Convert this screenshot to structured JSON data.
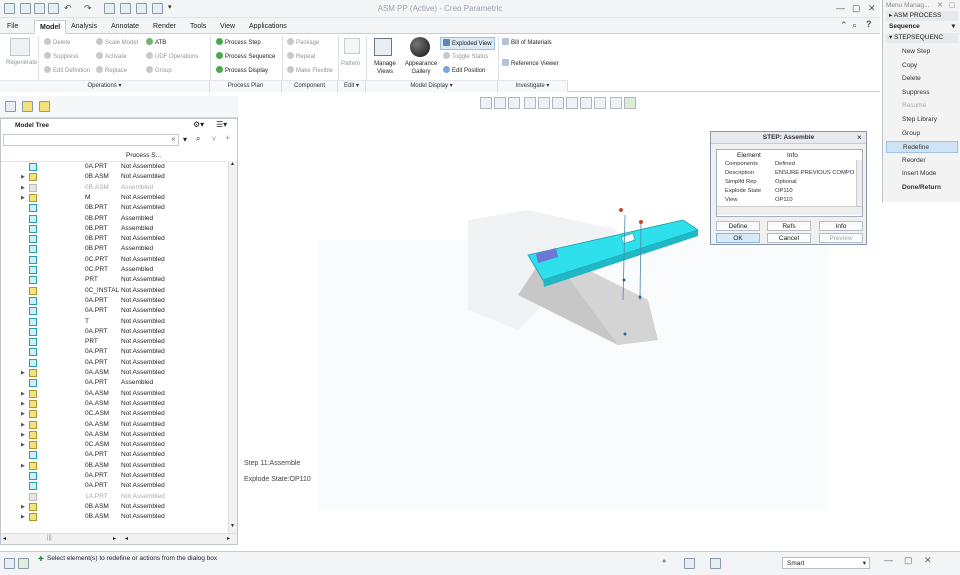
{
  "window": {
    "title": "ASM PP (Active) - Creo Parametric"
  },
  "tabs": [
    "File",
    "Model",
    "Analysis",
    "Annotate",
    "Render",
    "Tools",
    "View",
    "Applications"
  ],
  "ribbon": {
    "regenerate": "Regenerate",
    "operations": {
      "delete": "Delete",
      "suppress": "Suppress",
      "edit_definition": "Edit Definition",
      "scale_model": "Scale Model",
      "activate": "Activate",
      "replace": "Replace",
      "atb": "ATB",
      "udf_operations": "UDF Operations",
      "group": "Group"
    },
    "process": {
      "process_step": "Process Step",
      "process_sequence": "Process Sequence",
      "process_display": "Process Display"
    },
    "component": {
      "package": "Package",
      "repeat": "Repeat",
      "make_flexible": "Make Flexible"
    },
    "pattern": "Pattern",
    "model_display": {
      "manage_views": "Manage Views",
      "appearance_gallery": "Appearance Gallery",
      "exploded_view": "Exploded View",
      "toggle_status": "Toggle Status",
      "edit_position": "Edit Position"
    },
    "investigate": {
      "bom": "Bill of Materials",
      "reference_viewer": "Reference Viewer"
    },
    "groups": [
      "Operations",
      "Process Plan",
      "Component",
      "Edit",
      "Model Display",
      "Investigate"
    ]
  },
  "model_tree": {
    "title": "Model Tree",
    "column_header": "Process S...",
    "rows": [
      {
        "name": "0A.PRT",
        "status": "Not Assembled",
        "type": "prt",
        "tri": false,
        "dim": false
      },
      {
        "name": "0B.ASM",
        "status": "Not Assembled",
        "type": "asm",
        "tri": true,
        "dim": false
      },
      {
        "name": "0B.ASM",
        "status": "Assembled",
        "type": "gray",
        "tri": true,
        "dim": true
      },
      {
        "name": "M",
        "status": "Not Assembled",
        "type": "asm",
        "tri": true,
        "dim": false
      },
      {
        "name": "0B.PRT",
        "status": "Not Assembled",
        "type": "prt",
        "tri": false,
        "dim": false
      },
      {
        "name": "0B.PRT",
        "status": "Assembled",
        "type": "prt",
        "tri": false,
        "dim": false
      },
      {
        "name": "0B.PRT",
        "status": "Assembled",
        "type": "prt",
        "tri": false,
        "dim": false
      },
      {
        "name": "0B.PRT",
        "status": "Not Assembled",
        "type": "prt",
        "tri": false,
        "dim": false
      },
      {
        "name": "0B.PRT",
        "status": "Assembled",
        "type": "prt",
        "tri": false,
        "dim": false
      },
      {
        "name": "0C.PRT",
        "status": "Not Assembled",
        "type": "prt",
        "tri": false,
        "dim": false
      },
      {
        "name": "0C.PRT",
        "status": "Assembled",
        "type": "prt",
        "tri": false,
        "dim": false
      },
      {
        "name": "PRT",
        "status": "Not Assembled",
        "type": "prt",
        "tri": false,
        "dim": false
      },
      {
        "name": "0C_INSTAL",
        "status": "Not Assembled",
        "type": "asm",
        "tri": false,
        "dim": false
      },
      {
        "name": "0A.PRT",
        "status": "Not Assembled",
        "type": "prt",
        "tri": false,
        "dim": false
      },
      {
        "name": "0A.PRT",
        "status": "Not Assembled",
        "type": "prt",
        "tri": false,
        "dim": false
      },
      {
        "name": "T",
        "status": "Not Assembled",
        "type": "prt",
        "tri": false,
        "dim": false
      },
      {
        "name": "0A.PRT",
        "status": "Not Assembled",
        "type": "prt",
        "tri": false,
        "dim": false
      },
      {
        "name": "PRT",
        "status": "Not Assembled",
        "type": "prt",
        "tri": false,
        "dim": false
      },
      {
        "name": "0A.PRT",
        "status": "Not Assembled",
        "type": "prt",
        "tri": false,
        "dim": false
      },
      {
        "name": "0A.PRT",
        "status": "Not Assembled",
        "type": "prt",
        "tri": false,
        "dim": false
      },
      {
        "name": "0A.ASM",
        "status": "Not Assembled",
        "type": "asm",
        "tri": true,
        "dim": false
      },
      {
        "name": "0A.PRT",
        "status": "Assembled",
        "type": "prt",
        "tri": false,
        "dim": false
      },
      {
        "name": "0A.ASM",
        "status": "Not Assembled",
        "type": "asm",
        "tri": true,
        "dim": false
      },
      {
        "name": "0A.ASM",
        "status": "Not Assembled",
        "type": "asm",
        "tri": true,
        "dim": false
      },
      {
        "name": "0C.ASM",
        "status": "Not Assembled",
        "type": "asm",
        "tri": true,
        "dim": false
      },
      {
        "name": "0A.ASM",
        "status": "Not Assembled",
        "type": "asm",
        "tri": true,
        "dim": false
      },
      {
        "name": "0A.ASM",
        "status": "Not Assembled",
        "type": "asm",
        "tri": true,
        "dim": false
      },
      {
        "name": "0C.ASM",
        "status": "Not Assembled",
        "type": "asm",
        "tri": true,
        "dim": false
      },
      {
        "name": "0A.PRT",
        "status": "Not Assembled",
        "type": "prt",
        "tri": false,
        "dim": false
      },
      {
        "name": "0B.ASM",
        "status": "Not Assembled",
        "type": "asm",
        "tri": true,
        "dim": false
      },
      {
        "name": "0A.PRT",
        "status": "Not Assembled",
        "type": "prt",
        "tri": false,
        "dim": false
      },
      {
        "name": "0A.PRT",
        "status": "Not Assembled",
        "type": "prt",
        "tri": false,
        "dim": false
      },
      {
        "name": "1A.PRT",
        "status": "Not Assembled",
        "type": "gray",
        "tri": false,
        "dim": true
      },
      {
        "name": "0B.ASM",
        "status": "Not Assembled",
        "type": "asm",
        "tri": true,
        "dim": false
      },
      {
        "name": "0B.ASM",
        "status": "Not Assembled",
        "type": "asm",
        "tri": true,
        "dim": false
      }
    ]
  },
  "viewport": {
    "step_label": "Step 11:Assemble",
    "explode_state": "Explode State:OP110"
  },
  "step_dialog": {
    "title": "STEP: Assemble",
    "col_element": "Element",
    "col_info": "Info",
    "rows": [
      {
        "element": "Components",
        "info": "Defined"
      },
      {
        "element": "Description",
        "info": "ENSURE PREVIOUS COMPO"
      },
      {
        "element": "Simplfd Rep",
        "info": "Optional"
      },
      {
        "element": "Explode State",
        "info": "OP110"
      },
      {
        "element": "View",
        "info": "OP110"
      }
    ],
    "buttons": {
      "define": "Define",
      "refs": "Refs",
      "info": "Info",
      "ok": "OK",
      "cancel": "Cancel",
      "preview": "Preview"
    }
  },
  "menu_manager": {
    "title": "Menu Manag...",
    "asm_process": "ASM PROCESS",
    "sequence": "Sequence",
    "step_sequence": "STEPSEQUENC",
    "items": [
      {
        "label": "New Step",
        "state": "normal"
      },
      {
        "label": "Copy",
        "state": "normal"
      },
      {
        "label": "Delete",
        "state": "normal"
      },
      {
        "label": "Suppress",
        "state": "normal"
      },
      {
        "label": "Resume",
        "state": "disabled"
      },
      {
        "label": "Step Library",
        "state": "normal"
      },
      {
        "label": "Group",
        "state": "normal"
      },
      {
        "label": "Redefine",
        "state": "highlight"
      },
      {
        "label": "Reorder",
        "state": "normal"
      },
      {
        "label": "Insert Mode",
        "state": "normal"
      },
      {
        "label": "Done/Return",
        "state": "bold"
      }
    ]
  },
  "statusbar": {
    "message": "Select element(s) to redefine or actions from the dialog box",
    "filter": "Smart"
  },
  "colors": {
    "accent": "#2a6fc0",
    "model_cyan": "#2ee0ec",
    "selected_row": "#cfe3f5"
  }
}
